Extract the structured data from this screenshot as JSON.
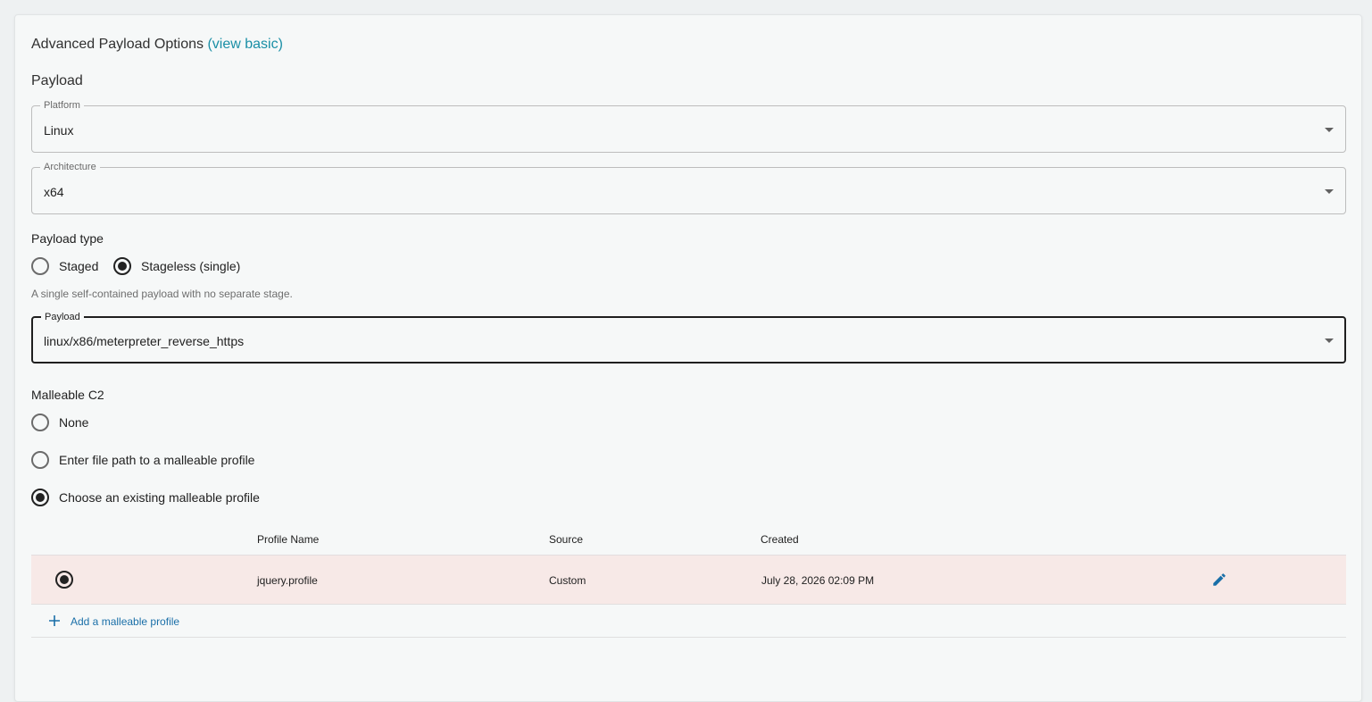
{
  "header": {
    "title": "Advanced Payload Options",
    "view_basic_link": "(view basic)"
  },
  "payload_section": {
    "heading": "Payload",
    "platform": {
      "label": "Platform",
      "value": "Linux"
    },
    "architecture": {
      "label": "Architecture",
      "value": "x64"
    },
    "payload_type": {
      "heading": "Payload type",
      "options": [
        {
          "label": "Staged",
          "selected": false
        },
        {
          "label": "Stageless (single)",
          "selected": true
        }
      ],
      "helper": "A single self-contained payload with no separate stage."
    },
    "payload": {
      "label": "Payload",
      "value": "linux/x86/meterpreter_reverse_https"
    }
  },
  "malleable": {
    "heading": "Malleable C2",
    "options": [
      {
        "label": "None",
        "selected": false
      },
      {
        "label": "Enter file path to a malleable profile",
        "selected": false
      },
      {
        "label": "Choose an existing malleable profile",
        "selected": true
      }
    ],
    "table": {
      "columns": [
        "Profile Name",
        "Source",
        "Created"
      ],
      "rows": [
        {
          "name": "jquery.profile",
          "source": "Custom",
          "created": "July 28, 2026 02:09 PM",
          "selected": true
        }
      ]
    },
    "add_link": "Add a malleable profile"
  },
  "colors": {
    "accent_link": "#1a8fa6",
    "action_blue": "#1a6fa8",
    "selected_row_bg": "#f7e9e7"
  },
  "icons": [
    "chevron-down-icon",
    "radio-icon",
    "edit-pencil-icon",
    "plus-icon"
  ]
}
